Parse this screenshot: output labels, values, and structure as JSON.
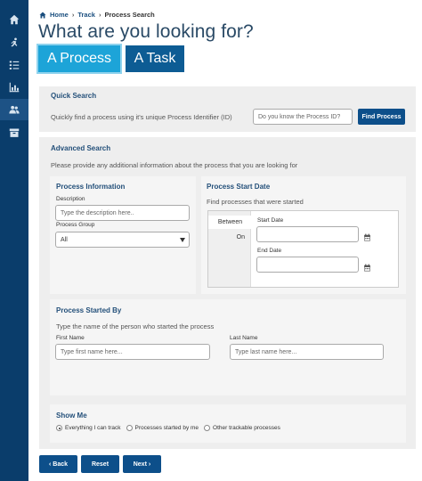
{
  "breadcrumb": {
    "home": "Home",
    "track": "Track",
    "current": "Process Search"
  },
  "page_title": "What are you looking for?",
  "type_buttons": {
    "process": "A Process",
    "task": "A Task"
  },
  "quick_search": {
    "title": "Quick Search",
    "description": "Quickly find a process using it's unique Process Identifier (ID)",
    "placeholder": "Do you know the Process ID?",
    "button": "Find Process"
  },
  "advanced_search": {
    "title": "Advanced Search",
    "description": "Please provide any additional information about the process that you are looking for"
  },
  "process_info": {
    "title": "Process Information",
    "description_label": "Description",
    "description_placeholder": "Type the description here..",
    "group_label": "Process Group",
    "group_value": "All"
  },
  "process_start": {
    "title": "Process Start Date",
    "subtitle": "Find processes that were started",
    "tabs": [
      "Between",
      "On"
    ],
    "start_label": "Start Date",
    "end_label": "End Date"
  },
  "started_by": {
    "title": "Process Started By",
    "subtitle": "Type the name of the person who started the process",
    "first_label": "First Name",
    "first_placeholder": "Type first name here...",
    "last_label": "Last Name",
    "last_placeholder": "Type last name here..."
  },
  "show_me": {
    "title": "Show Me",
    "options": [
      "Everything I can track",
      "Processes started by me",
      "Other trackable processes"
    ],
    "selected": 0
  },
  "nav": {
    "back": "Back",
    "reset": "Reset",
    "next": "Next"
  },
  "colors": {
    "rail": "#0a3d6b",
    "accent": "#1da4d8",
    "primary": "#0d4f8a",
    "heading": "#24507a"
  },
  "rail_icons": [
    "home-icon",
    "runner-icon",
    "list-check-icon",
    "bar-chart-icon",
    "users-icon",
    "archive-icon"
  ]
}
